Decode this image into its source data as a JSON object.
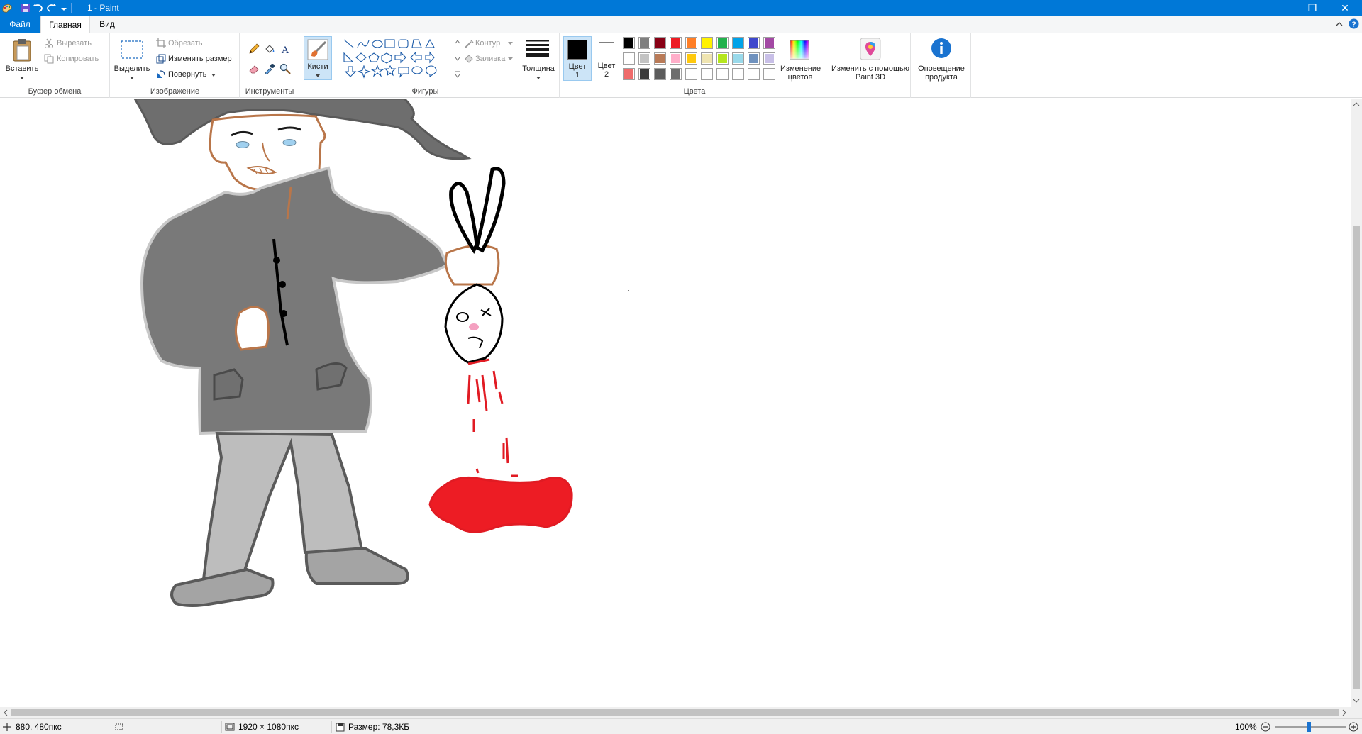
{
  "window": {
    "title": "1 - Paint",
    "minimize": "—",
    "restore": "❐",
    "close": "✕"
  },
  "tabs": {
    "file": "Файл",
    "home": "Главная",
    "view": "Вид"
  },
  "clipboard": {
    "paste": "Вставить",
    "cut": "Вырезать",
    "copy": "Копировать",
    "group_label": "Буфер обмена"
  },
  "image": {
    "select": "Выделить",
    "crop": "Обрезать",
    "resize": "Изменить размер",
    "rotate": "Повернуть",
    "group_label": "Изображение"
  },
  "tools": {
    "group_label": "Инструменты",
    "brushes": "Кисти"
  },
  "shapes": {
    "outline": "Контур",
    "fill": "Заливка",
    "group_label": "Фигуры"
  },
  "thickness": {
    "label": "Толщина"
  },
  "colors": {
    "color1_label": "Цвет",
    "color1_num": "1",
    "color2_label": "Цвет",
    "color2_num": "2",
    "edit_colors": "Изменение цветов",
    "group_label": "Цвета",
    "color1_value": "#000000",
    "color2_value": "#ffffff",
    "palette": [
      "#000000",
      "#7f7f7f",
      "#880015",
      "#ed1c24",
      "#ff7f27",
      "#fff200",
      "#22b14c",
      "#00a2e8",
      "#3f48cc",
      "#a349a4",
      "#ffffff",
      "#c3c3c3",
      "#b97a57",
      "#ffaec9",
      "#ffc90e",
      "#efe4b0",
      "#b5e61d",
      "#99d9ea",
      "#7092be",
      "#c8bfe7",
      "#ef6b6b",
      "#3a3a3a",
      "#5c5c5c",
      "#6e6e6e",
      "#ffffff",
      "#ffffff",
      "#ffffff",
      "#ffffff",
      "#ffffff",
      "#ffffff"
    ]
  },
  "paint3d": {
    "label": "Изменить с помощью Paint 3D"
  },
  "notification": {
    "label": "Оповещение продукта"
  },
  "status": {
    "cursor_pos": "880, 480пкс",
    "image_size": "1920 × 1080пкс",
    "file_size": "Размер: 78,3КБ",
    "zoom": "100%"
  }
}
